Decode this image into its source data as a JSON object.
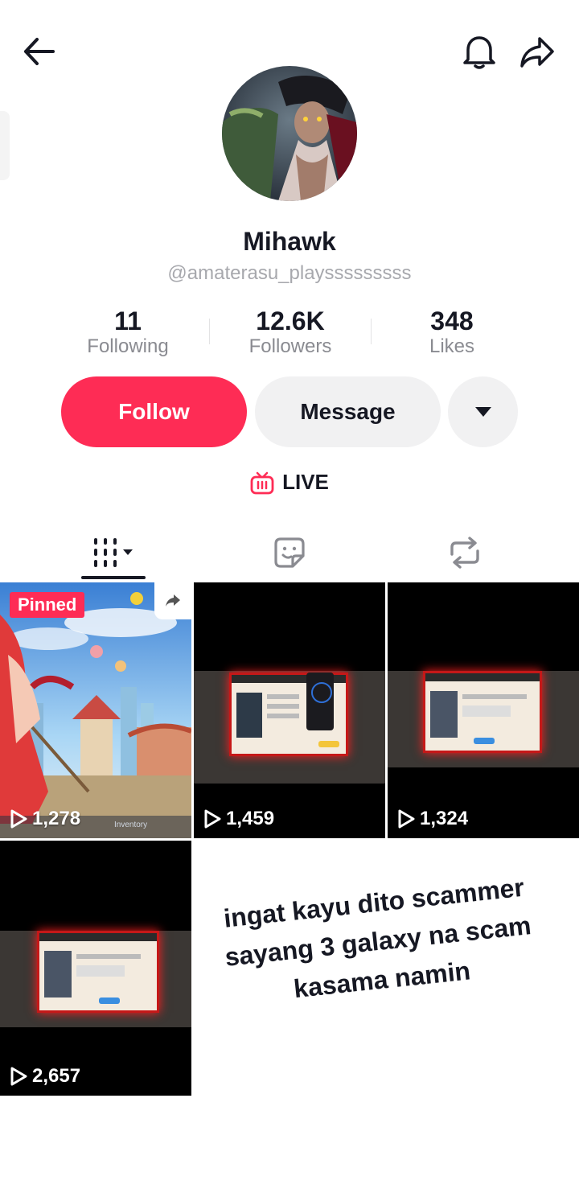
{
  "header": {
    "back_icon": "arrow-left-icon",
    "bell_icon": "bell-icon",
    "share_icon": "share-arrow-icon"
  },
  "profile": {
    "name": "Mihawk",
    "handle": "@amaterasu_playsssssssss"
  },
  "stats": [
    {
      "value": "11",
      "label": "Following"
    },
    {
      "value": "12.6K",
      "label": "Followers"
    },
    {
      "value": "348",
      "label": "Likes"
    }
  ],
  "actions": {
    "follow_label": "Follow",
    "message_label": "Message",
    "more_icon": "caret-down-icon"
  },
  "live": {
    "label": "LIVE",
    "icon": "tv-icon"
  },
  "tabs": [
    {
      "icon": "grid-icon",
      "active": true
    },
    {
      "icon": "sticker-icon",
      "active": false
    },
    {
      "icon": "repost-icon",
      "active": false
    }
  ],
  "videos": [
    {
      "views": "1,278",
      "badge": "Pinned",
      "overlay_text": "Inventory"
    },
    {
      "views": "1,459"
    },
    {
      "views": "1,324"
    },
    {
      "views": "2,657"
    }
  ],
  "caption": {
    "line1": "ingat kayu dito scammer",
    "line2": "sayang 3 galaxy na scam",
    "line3": "kasama namin"
  },
  "colors": {
    "accent": "#fe2c55",
    "text": "#161823",
    "muted": "#8a8b91",
    "button_bg": "#f1f1f2"
  }
}
